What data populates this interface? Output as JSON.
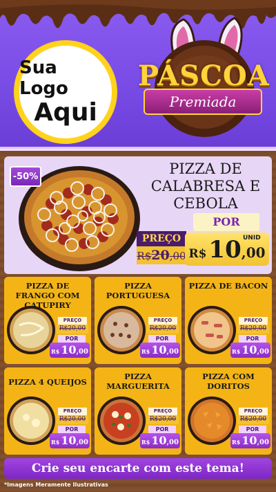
{
  "header": {
    "logo_line1": "Sua Logo",
    "logo_line2": "Aqui",
    "title": "PÁSCOA",
    "subtitle": "Premiada"
  },
  "featured": {
    "discount": "-50%",
    "name": "PIZZA DE CALABRESA E CEBOLA",
    "preco_label": "PREÇO",
    "old_currency": "R$",
    "old_price_int": "20",
    "old_price_cents": ",00",
    "por_label": "POR",
    "unit_label": "UNID",
    "currency": "R$",
    "price_int": "10",
    "price_cents": ",00"
  },
  "cards": [
    {
      "name": "PIZZA DE FRANGO COM CATUPIRY",
      "preco_label": "PREÇO",
      "old_price": "R$20,00",
      "por_label": "POR",
      "currency": "R$",
      "price_int": "10",
      "price_cents": ",00"
    },
    {
      "name": "PIZZA PORTUGUESA",
      "preco_label": "PREÇO",
      "old_price": "R$20,00",
      "por_label": "POR",
      "currency": "R$",
      "price_int": "10",
      "price_cents": ",00"
    },
    {
      "name": "PIZZA DE BACON",
      "preco_label": "PREÇO",
      "old_price": "R$20,00",
      "por_label": "POR",
      "currency": "R$",
      "price_int": "10",
      "price_cents": ",00"
    },
    {
      "name": "PIZZA 4 QUEIJOS",
      "preco_label": "PREÇO",
      "old_price": "R$20,00",
      "por_label": "POR",
      "currency": "R$",
      "price_int": "10",
      "price_cents": ",00"
    },
    {
      "name": "PIZZA MARGUERITA",
      "preco_label": "PREÇO",
      "old_price": "R$20,00",
      "por_label": "POR",
      "currency": "R$",
      "price_int": "10",
      "price_cents": ",00"
    },
    {
      "name": "PIZZA COM DORITOS",
      "preco_label": "PREÇO",
      "old_price": "R$20,00",
      "por_label": "POR",
      "currency": "R$",
      "price_int": "10",
      "price_cents": ",00"
    }
  ],
  "footer": {
    "cta": "Crie seu encarte com este tema!",
    "disclaimer": "*Imagens Meramente Ilustrativas"
  },
  "colors": {
    "header_purple": "#7a4ce6",
    "gold": "#ffd43b",
    "card_yellow": "#f5b415",
    "price_purple": "#8a2cc4",
    "chocolate": "#5a2e14"
  }
}
